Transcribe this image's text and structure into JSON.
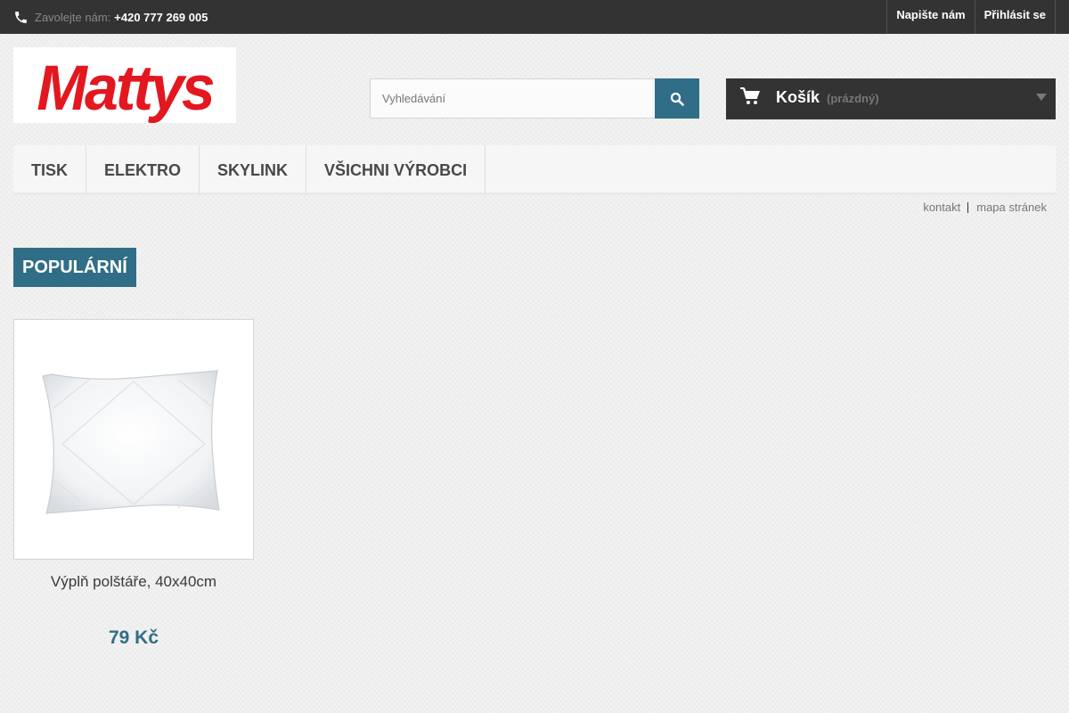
{
  "topbar": {
    "phone_icon": "phone-icon",
    "phone_label": "Zavolejte nám:",
    "phone_number": "+420 777 269 005",
    "links": [
      "Napište nám",
      "Přihlásit se"
    ]
  },
  "logo": {
    "text": "Mattys",
    "color": "#e3171f"
  },
  "search": {
    "placeholder": "Vyhledávání",
    "value": "",
    "button_icon": "search-icon"
  },
  "cart": {
    "icon": "cart-icon",
    "title": "Košík",
    "status": "(prázdný)",
    "caret_icon": "caret-down-icon"
  },
  "menu": {
    "items": [
      "TISK",
      "ELEKTRO",
      "SKYLINK",
      "VŠICHNI VÝROBCI"
    ]
  },
  "permanent_links": [
    "kontakt",
    "mapa stránek"
  ],
  "tabs": {
    "popular": "POPULÁRNÍ"
  },
  "products": [
    {
      "name": "Výplň polštáře, 40x40cm",
      "price": "79 Kč",
      "image": "pillow-image"
    }
  ],
  "colors": {
    "accent": "#2f6e86",
    "topbar": "#333333",
    "brand_red": "#e3171f"
  }
}
